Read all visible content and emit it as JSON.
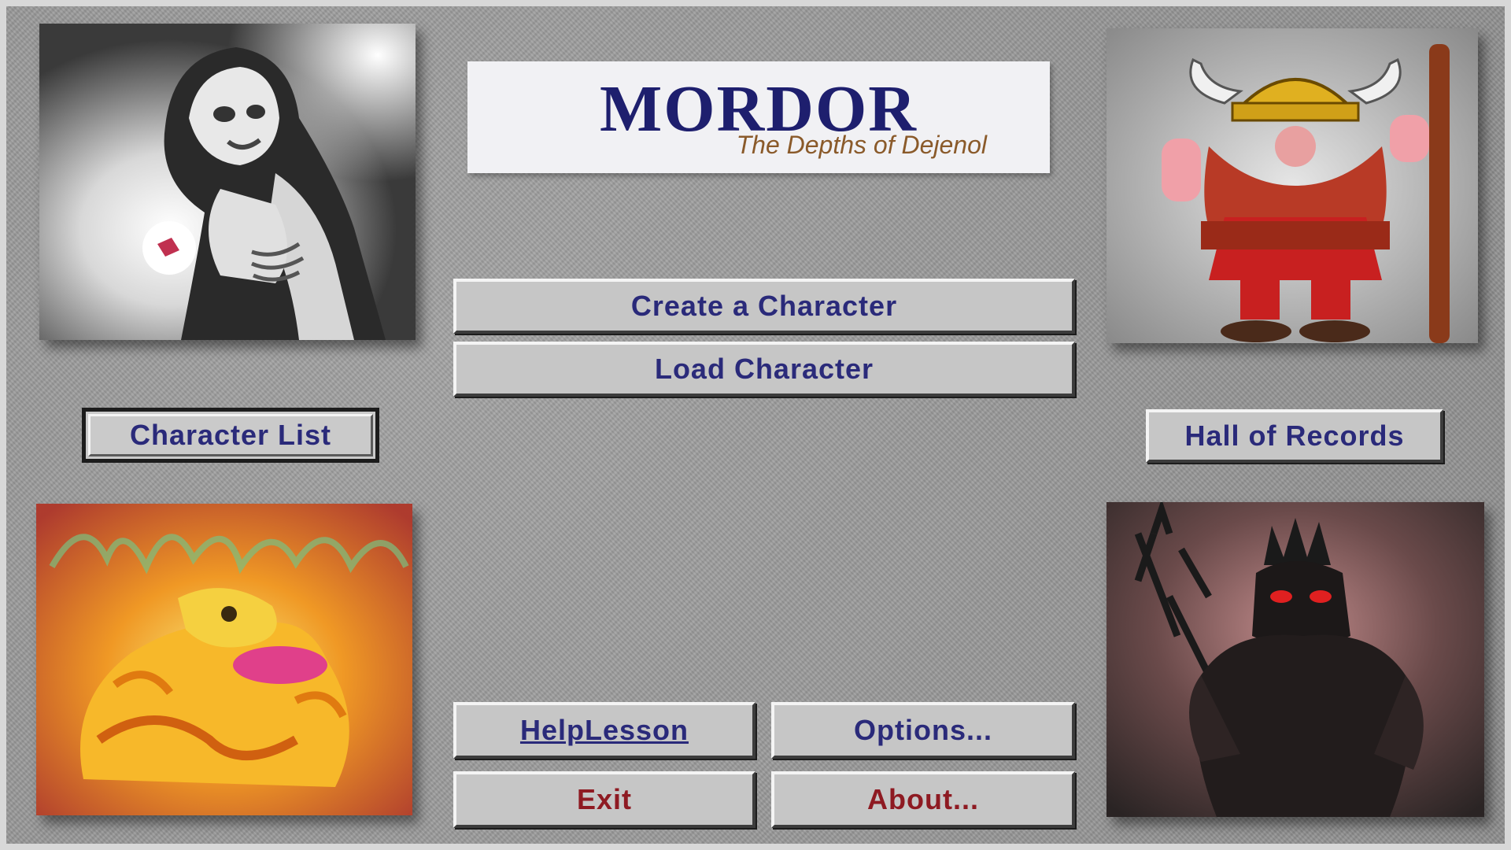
{
  "logo": {
    "title": "MORDOR",
    "subtitle": "The Depths of Dejenol"
  },
  "buttons": {
    "create_character": "Create a Character",
    "load_character": "Load Character",
    "character_list": "Character List",
    "hall_of_records": "Hall of Records",
    "help_lesson": "HelpLesson",
    "options": "Options...",
    "exit": "Exit",
    "about": "About..."
  },
  "colors": {
    "button_text": "#2a2a7a",
    "exit_text": "#8e1a22",
    "logo_title": "#1e1f6e",
    "logo_subtitle": "#8a5a2a"
  },
  "portraits": [
    "hooded-figure-image",
    "viking-warrior-image",
    "fire-dragon-image",
    "horned-demon-image"
  ]
}
